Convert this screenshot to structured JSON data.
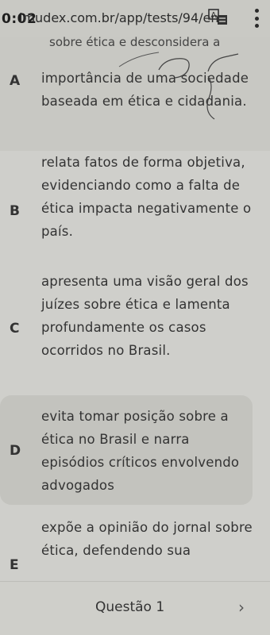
{
  "browser": {
    "timer": "0:02",
    "url": "imudex.com.br/app/tests/94/ens"
  },
  "options": {
    "a": {
      "partial_top": "sobre ética e desconsidera a",
      "letter": "A",
      "text": "importância de uma sociedade baseada em ética e cidadania."
    },
    "b": {
      "letter": "B",
      "text": "relata fatos de forma objetiva, evidenciando como a falta de ética impacta negativamente o país."
    },
    "c": {
      "letter": "C",
      "text": "apresenta uma visão geral dos juízes sobre ética e lamenta profundamente os casos ocorridos no Brasil."
    },
    "d": {
      "letter": "D",
      "text": "evita tomar posição sobre a ética no Brasil e narra episódios críticos envolvendo advogados"
    },
    "e": {
      "letter": "E",
      "text": "expõe a opinião do jornal sobre ética, defendendo sua"
    }
  },
  "footer": {
    "question_label": "Questão 1",
    "next_symbol": "›"
  }
}
